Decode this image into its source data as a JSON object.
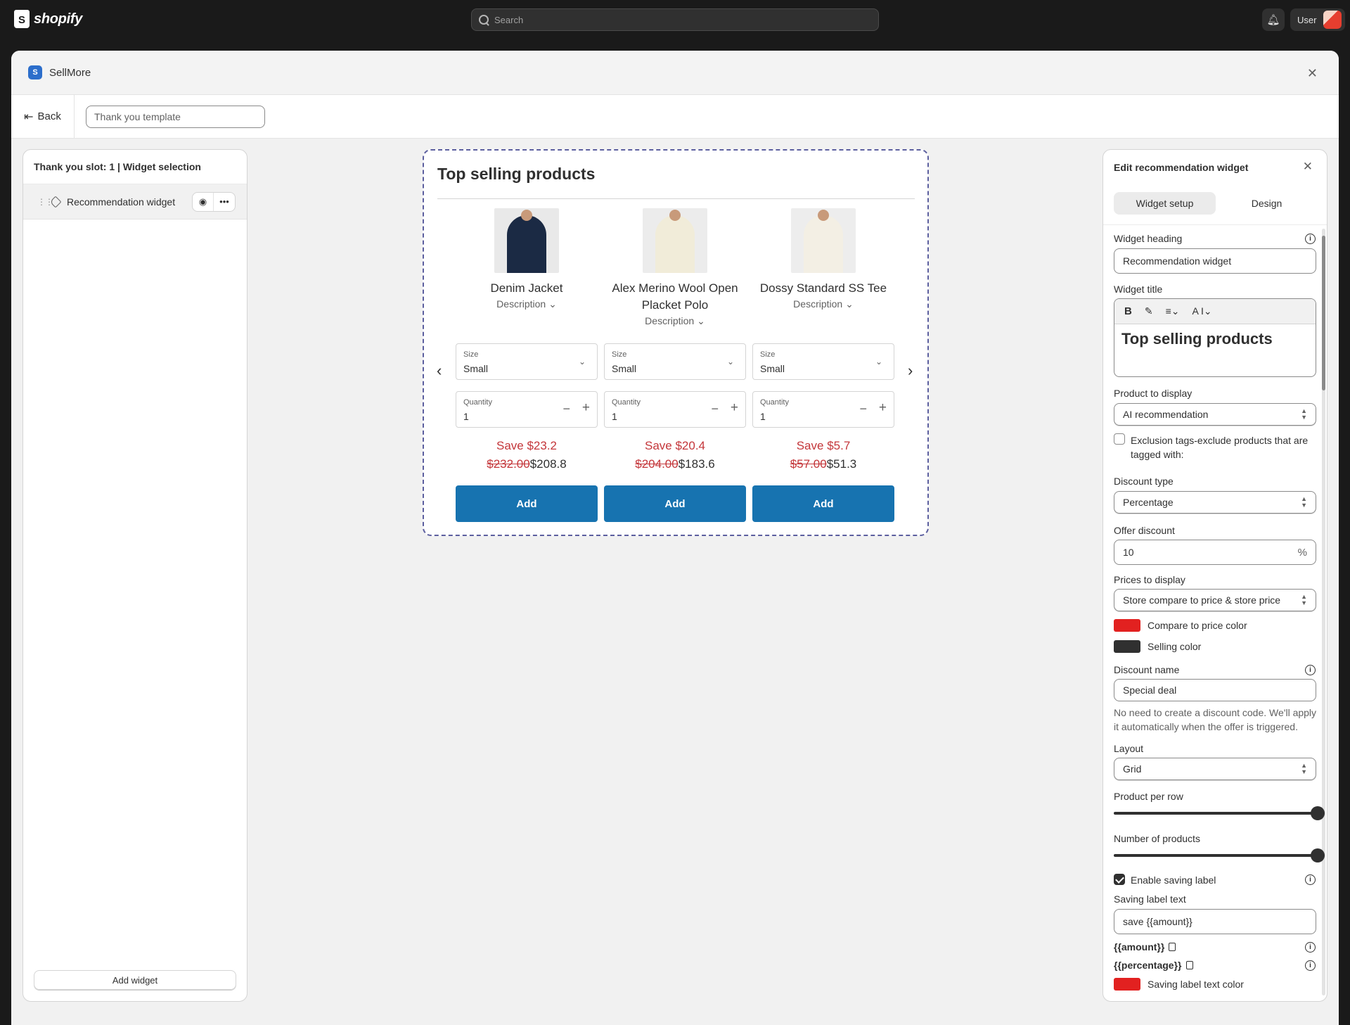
{
  "topbar": {
    "brand": "shopify",
    "search_placeholder": "Search",
    "user_label": "User"
  },
  "window": {
    "app_title": "SellMore",
    "back_label": "Back",
    "template_name": "Thank you template"
  },
  "left_panel": {
    "heading": "Thank you slot: 1 | Widget selection",
    "widget_item_label": "Recommendation widget",
    "add_widget_label": "Add widget"
  },
  "preview": {
    "title": "Top selling products",
    "products": [
      {
        "name": "Denim Jacket",
        "description_label": "Description",
        "size_label": "Size",
        "size_value": "Small",
        "quantity_label": "Quantity",
        "quantity_value": "1",
        "save_text": "Save $23.2",
        "compare_price": "$232.00",
        "price": "$208.8",
        "add_label": "Add",
        "image_colors": [
          "#1b2a44",
          "#e9e9e9"
        ]
      },
      {
        "name": "Alex Merino Wool Open Placket Polo",
        "description_label": "Description",
        "size_label": "Size",
        "size_value": "Small",
        "quantity_label": "Quantity",
        "quantity_value": "1",
        "save_text": "Save $20.4",
        "compare_price": "$204.00",
        "price": "$183.6",
        "add_label": "Add",
        "image_colors": [
          "#f1ecd9",
          "#ececec"
        ]
      },
      {
        "name": "Dossy Standard SS Tee",
        "description_label": "Description",
        "size_label": "Size",
        "size_value": "Small",
        "quantity_label": "Quantity",
        "quantity_value": "1",
        "save_text": "Save $5.7",
        "compare_price": "$57.00",
        "price": "$51.3",
        "add_label": "Add",
        "image_colors": [
          "#f3efe4",
          "#ededed"
        ]
      }
    ]
  },
  "right_panel": {
    "heading": "Edit recommendation widget",
    "tabs": [
      "Widget setup",
      "Design"
    ],
    "widget_heading_label": "Widget heading",
    "widget_heading_value": "Recommendation widget",
    "widget_title_label": "Widget title",
    "widget_title_value": "Top selling products",
    "product_to_display_label": "Product to display",
    "product_to_display_value": "AI recommendation",
    "exclusion_label": "Exclusion tags-exclude products that are tagged with:",
    "discount_type_label": "Discount type",
    "discount_type_value": "Percentage",
    "offer_discount_label": "Offer discount",
    "offer_discount_value": "10",
    "offer_discount_suffix": "%",
    "prices_to_display_label": "Prices to display",
    "prices_to_display_value": "Store compare to price & store price",
    "compare_color_label": "Compare to price color",
    "compare_color": "#e22120",
    "selling_color_label": "Selling color",
    "selling_color": "#303030",
    "discount_name_label": "Discount name",
    "discount_name_value": "Special deal",
    "discount_help": "No need to create a discount code. We'll apply it automatically when the offer is triggered.",
    "layout_label": "Layout",
    "layout_value": "Grid",
    "product_per_row_label": "Product per row",
    "product_per_row_level": 1.0,
    "number_of_products_label": "Number of products",
    "number_of_products_level": 1.0,
    "enable_saving_label": "Enable saving label",
    "saving_label_text_label": "Saving label text",
    "saving_label_text_value": "save {{amount}}",
    "token_amount": "{{amount}}",
    "token_percentage": "{{percentage}}",
    "saving_label_color_label": "Saving label text color",
    "saving_label_color": "#e22120"
  },
  "colors": {
    "primary_button": "#1773b0",
    "sale_text": "#c4363a",
    "preview_border": "#5c5f9f"
  }
}
